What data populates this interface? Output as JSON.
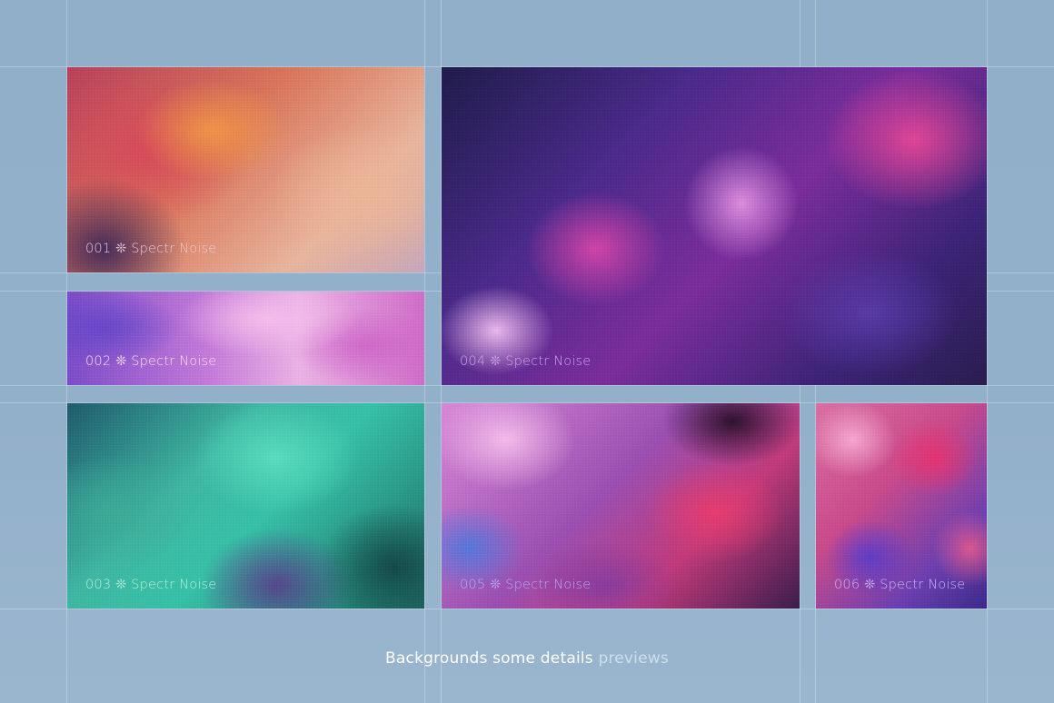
{
  "caption": {
    "main": "Backgrounds some details",
    "muted": "previews"
  },
  "tiles": [
    {
      "label": "001 ❊ Spectr Noise",
      "label_color": "#e8c7d6"
    },
    {
      "label": "002 ❊ Spectr Noise",
      "label_color": "#f6e3f1"
    },
    {
      "label": "003 ❊ Spectr Noise",
      "label_color": "#b9ecdd"
    },
    {
      "label": "004 ❊ Spectr Noise",
      "label_color": "#c9a6e8"
    },
    {
      "label": "005 ❊ Spectr Noise",
      "label_color": "#b9a7ec"
    },
    {
      "label": "006 ❊ Spectr Noise",
      "label_color": "#c9b7f2"
    }
  ],
  "colors": {
    "page_background": "#93b0ca",
    "guide_lines": "rgba(255,255,255,0.28)",
    "caption_text": "#ffffff"
  }
}
